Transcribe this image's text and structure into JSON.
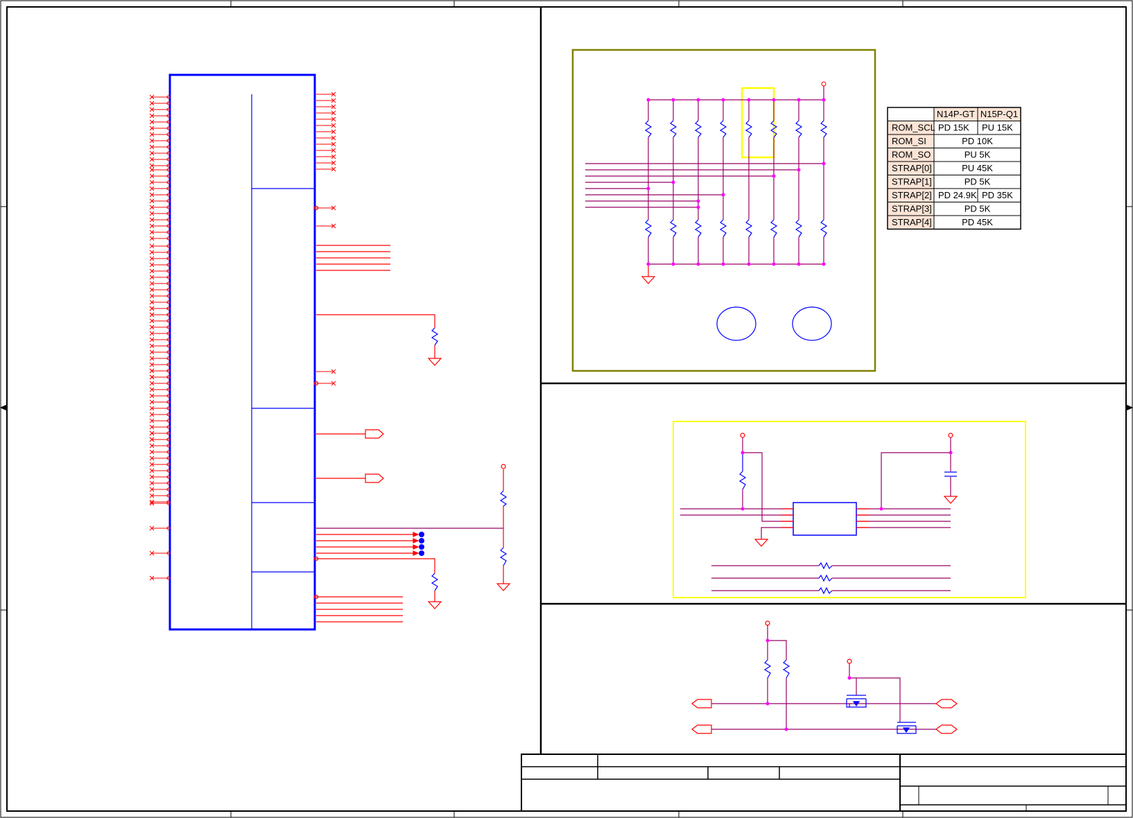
{
  "strap_table": {
    "columns": [
      "",
      "N14P-GT",
      "N15P-Q1"
    ],
    "rows": [
      {
        "signal": "ROM_SCL",
        "n14p_gt": "PD 15K",
        "n15p_q1": "PU 15K"
      },
      {
        "signal": "ROM_SI",
        "both": "PD 10K"
      },
      {
        "signal": "ROM_SO",
        "both": "PU 5K"
      },
      {
        "signal": "STRAP[0]",
        "both": "PU 45K"
      },
      {
        "signal": "STRAP[1]",
        "both": "PD 5K"
      },
      {
        "signal": "STRAP[2]",
        "n14p_gt": "PD 24.9K",
        "n15p_q1": "PD 35K"
      },
      {
        "signal": "STRAP[3]",
        "both": "PD 5K"
      },
      {
        "signal": "STRAP[4]",
        "both": "PD 45K"
      }
    ]
  },
  "colors": {
    "frame": "#000000",
    "gpu_symbol": "#0000ff",
    "wire": "#990066",
    "pin": "#ff0000",
    "strap_box": "#808000",
    "highlight": "#ffff00",
    "table_header_fill": "#fce4d6",
    "net_dot": "#ff00ff"
  }
}
